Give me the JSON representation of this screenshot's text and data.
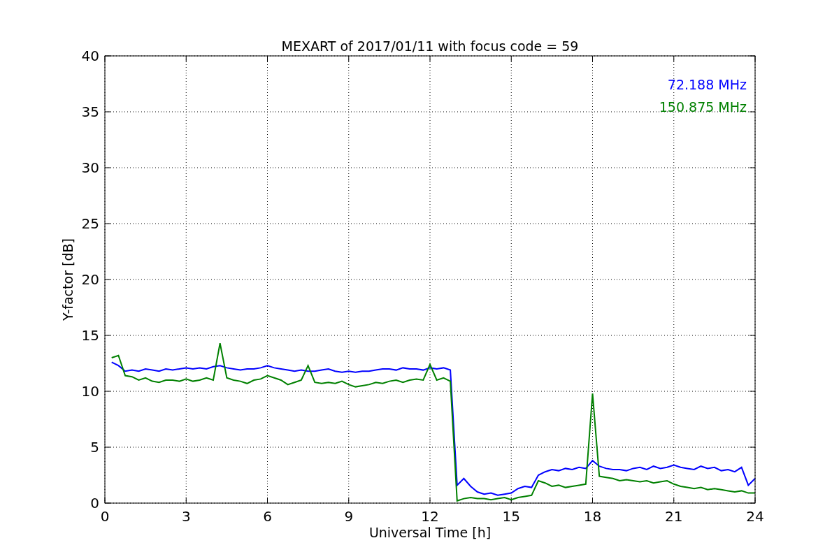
{
  "figure": {
    "chart_data": {
      "type": "line",
      "title": "MEXART of 2017/01/11 with focus code = 59",
      "xlabel": "Universal Time [h]",
      "ylabel": "Y-factor [dB]",
      "x": [
        0.25,
        0.5,
        0.75,
        1,
        1.25,
        1.5,
        1.75,
        2,
        2.25,
        2.5,
        2.75,
        3,
        3.25,
        3.5,
        3.75,
        4,
        4.25,
        4.5,
        4.75,
        5,
        5.25,
        5.5,
        5.75,
        6,
        6.25,
        6.5,
        6.75,
        7,
        7.25,
        7.5,
        7.75,
        8,
        8.25,
        8.5,
        8.75,
        9,
        9.25,
        9.5,
        9.75,
        10,
        10.25,
        10.5,
        10.75,
        11,
        11.25,
        11.5,
        11.75,
        12,
        12.25,
        12.5,
        12.75,
        13,
        13.25,
        13.5,
        13.75,
        14,
        14.25,
        14.5,
        14.75,
        15,
        15.25,
        15.5,
        15.75,
        16,
        16.25,
        16.5,
        16.75,
        17,
        17.25,
        17.5,
        17.75,
        18,
        18.25,
        18.5,
        18.75,
        19,
        19.25,
        19.5,
        19.75,
        20,
        20.25,
        20.5,
        20.75,
        21,
        21.25,
        21.5,
        21.75,
        22,
        22.25,
        22.5,
        22.75,
        23,
        23.25,
        23.5,
        23.75,
        24
      ],
      "series": [
        {
          "name": "72.188 MHz",
          "color": "#0000ff",
          "values": [
            12.6,
            12.3,
            11.8,
            11.9,
            11.8,
            12.0,
            11.9,
            11.8,
            12.0,
            11.9,
            12.0,
            12.1,
            12.0,
            12.1,
            12.0,
            12.2,
            12.3,
            12.1,
            12.0,
            11.9,
            12.0,
            12.0,
            12.1,
            12.3,
            12.1,
            12.0,
            11.9,
            11.8,
            11.9,
            11.8,
            11.8,
            11.9,
            12.0,
            11.8,
            11.7,
            11.8,
            11.7,
            11.8,
            11.8,
            11.9,
            12.0,
            12.0,
            11.9,
            12.1,
            12.0,
            12.0,
            11.9,
            12.1,
            12.0,
            12.1,
            11.9,
            1.6,
            2.2,
            1.5,
            1.0,
            0.8,
            0.9,
            0.7,
            0.8,
            0.9,
            1.3,
            1.5,
            1.4,
            2.5,
            2.8,
            3.0,
            2.9,
            3.1,
            3.0,
            3.2,
            3.1,
            3.8,
            3.3,
            3.1,
            3.0,
            3.0,
            2.9,
            3.1,
            3.2,
            3.0,
            3.3,
            3.1,
            3.2,
            3.4,
            3.2,
            3.1,
            3.0,
            3.3,
            3.1,
            3.2,
            2.9,
            3.0,
            2.8,
            3.2,
            1.6,
            2.2
          ]
        },
        {
          "name": "150.875 MHz",
          "color": "#008000",
          "values": [
            13.0,
            13.2,
            11.4,
            11.3,
            11.0,
            11.2,
            10.9,
            10.8,
            11.0,
            11.0,
            10.9,
            11.1,
            10.9,
            11.0,
            11.2,
            11.0,
            14.3,
            11.2,
            11.0,
            10.9,
            10.7,
            11.0,
            11.1,
            11.4,
            11.2,
            11.0,
            10.6,
            10.8,
            11.0,
            12.3,
            10.8,
            10.7,
            10.8,
            10.7,
            10.9,
            10.6,
            10.4,
            10.5,
            10.6,
            10.8,
            10.7,
            10.9,
            11.0,
            10.8,
            11.0,
            11.1,
            11.0,
            12.4,
            11.0,
            11.2,
            10.9,
            0.2,
            0.4,
            0.5,
            0.4,
            0.4,
            0.3,
            0.4,
            0.5,
            0.3,
            0.5,
            0.6,
            0.7,
            2.0,
            1.8,
            1.5,
            1.6,
            1.4,
            1.5,
            1.6,
            1.7,
            9.8,
            2.4,
            2.3,
            2.2,
            2.0,
            2.1,
            2.0,
            1.9,
            2.0,
            1.8,
            1.9,
            2.0,
            1.7,
            1.5,
            1.4,
            1.3,
            1.4,
            1.2,
            1.3,
            1.2,
            1.1,
            1.0,
            1.1,
            0.9,
            0.9
          ]
        }
      ],
      "grid": true,
      "xlim": [
        0,
        24
      ],
      "ylim": [
        0,
        40
      ],
      "xticks": [
        0,
        3,
        6,
        9,
        12,
        15,
        18,
        21,
        24
      ],
      "yticks": [
        0,
        5,
        10,
        15,
        20,
        25,
        30,
        35,
        40
      ]
    }
  }
}
